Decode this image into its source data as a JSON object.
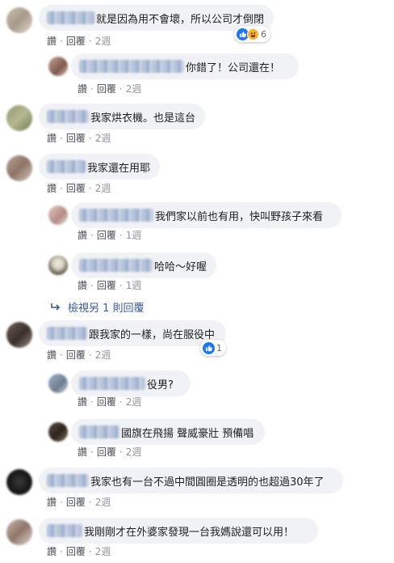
{
  "actions": {
    "like": "讚",
    "reply": "回覆",
    "sep": "·"
  },
  "comments": [
    {
      "text": "就是因為用不會壞，所以公司才倒閉",
      "time": "2週",
      "reactions": "6"
    },
    {
      "text": "你錯了！公司還在！",
      "time": "2週"
    },
    {
      "text": "我家烘衣機。也是這台",
      "time": "2週"
    },
    {
      "text": "我家還在用耶",
      "time": "2週"
    },
    {
      "text": "我們家以前也有用，快叫野孩子來看",
      "time": "1週"
    },
    {
      "text": "哈哈～好喔",
      "time": "1週"
    },
    {
      "text": "跟我家的一樣，尚在服役中",
      "time": "2週",
      "reactions": "1"
    },
    {
      "text": "役男?",
      "time": "2週"
    },
    {
      "text": "國旗在飛揚 聲威豪壯 預備唱",
      "time": "2週"
    },
    {
      "text": "我家也有一台不過中間圓圈是透明的也超過30年了",
      "time": "2週"
    },
    {
      "text": "我剛剛才在外婆家發現一台我媽說還可以用！",
      "time": "2週"
    }
  ],
  "view_more_replies": "檢視另 1 則回覆",
  "colors": {
    "bubble": "#f0f2f5",
    "link": "#385898",
    "like_blue": "#1877f2",
    "haha_yellow": "#f7b125"
  }
}
